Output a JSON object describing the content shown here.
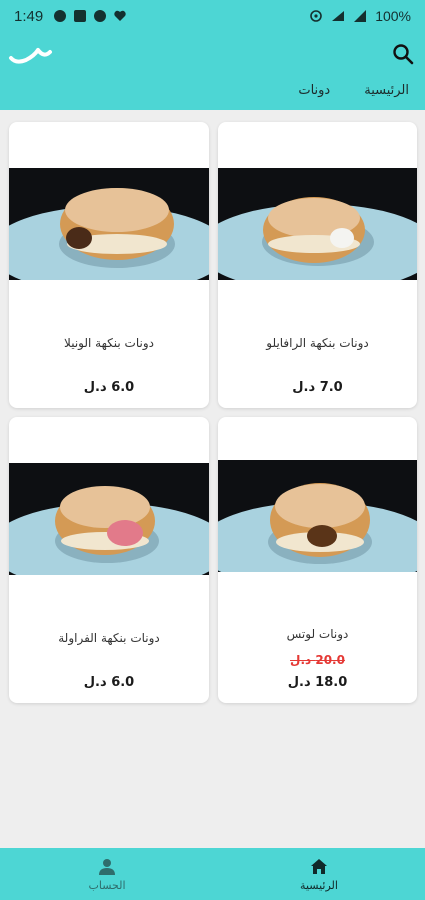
{
  "status_bar": {
    "time": "1:49",
    "battery": "100%"
  },
  "app_bar": {
    "tabs": [
      {
        "label": "الرئيسية"
      },
      {
        "label": "دونات"
      }
    ]
  },
  "products": [
    {
      "name": "دونات بنكهة الرافايلو",
      "price": "7.0 د.ل",
      "old_price": "",
      "filling": "cream"
    },
    {
      "name": "دونات بنكهة الونيلا",
      "price": "6.0 د.ل",
      "old_price": "",
      "filling": "chocolate"
    },
    {
      "name": "دونات لوتس",
      "price": "18.0 د.ل",
      "old_price": "20.0 د.ل",
      "filling": "caramel"
    },
    {
      "name": "دونات بنكهة الفراولة",
      "price": "6.0 د.ل",
      "old_price": "",
      "filling": "strawberry"
    }
  ],
  "bottom_nav": {
    "home_label": "الرئيسية",
    "account_label": "الحساب"
  },
  "colors": {
    "accent": "#4dd6d4",
    "discount": "#e53935"
  }
}
